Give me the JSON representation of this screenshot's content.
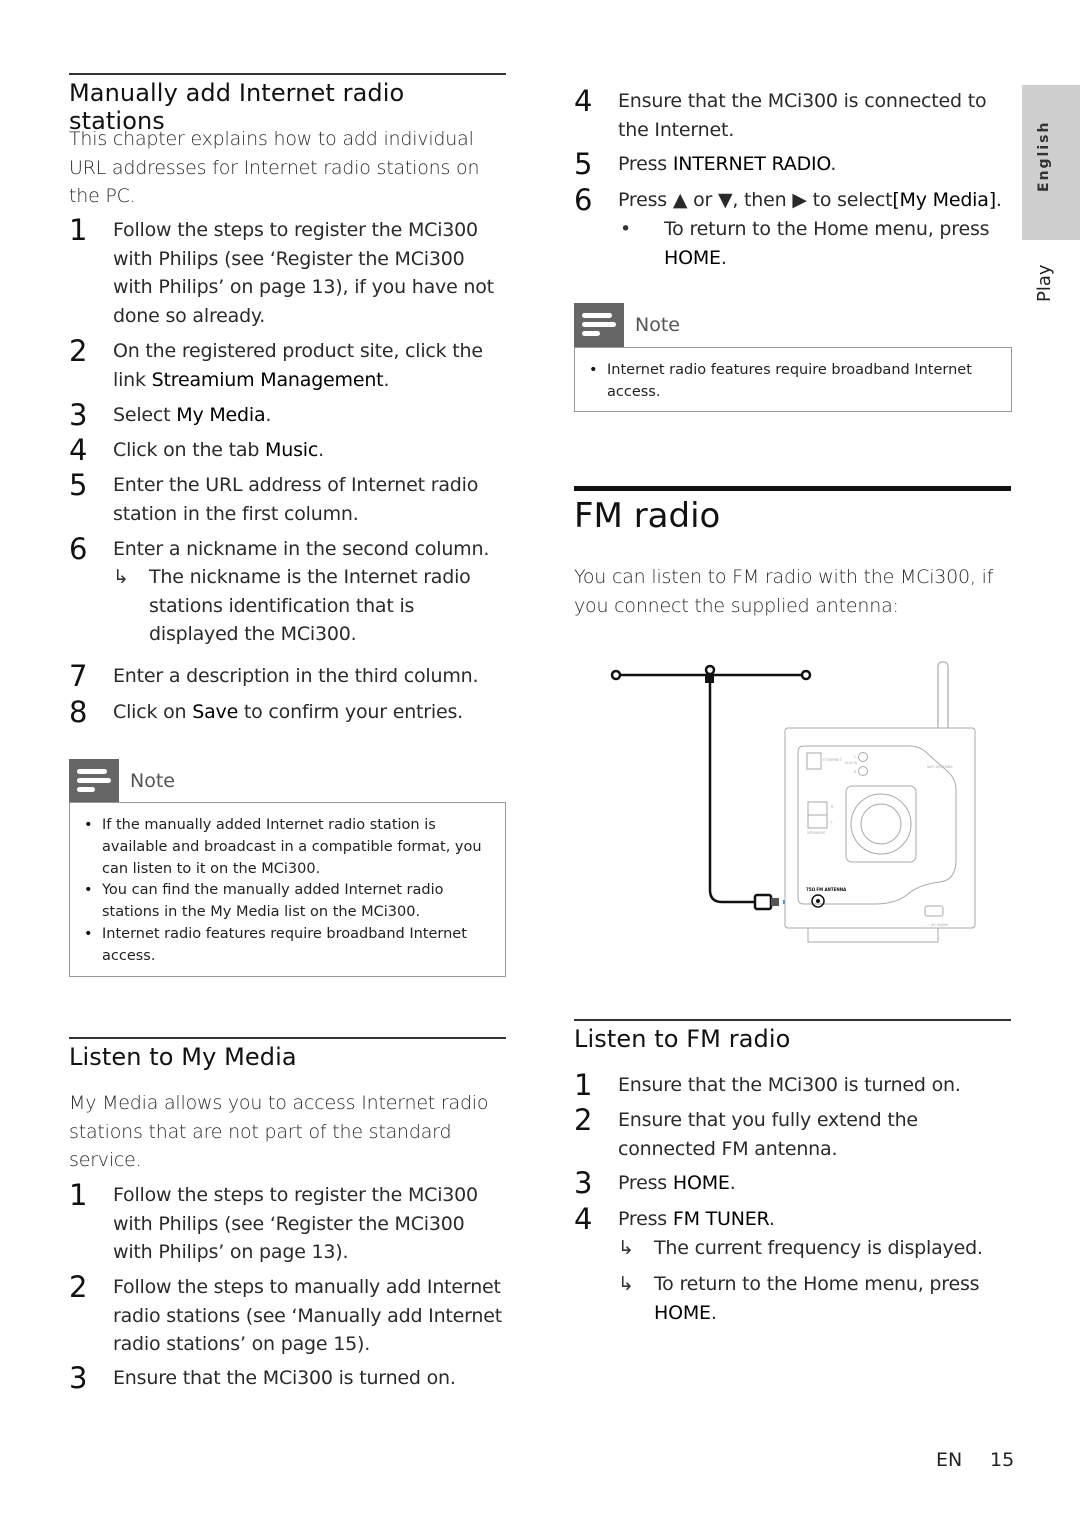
{
  "side_tabs": {
    "language": "English",
    "section": "Play"
  },
  "left": {
    "manual_add": {
      "title": "Manually add Internet radio stations",
      "intro": "This chapter explains how to add individual URL addresses for Internet radio stations on the PC.",
      "steps": [
        {
          "num": "1",
          "text": "Follow the steps to register the MCi300 with Philips (see ‘Register the MCi300 with Philips’ on page 13), if you have not done so already."
        },
        {
          "num": "2",
          "pre": "On the registered product site, click the link ",
          "bold": "Streamium Management",
          "post": "."
        },
        {
          "num": "3",
          "pre": "Select ",
          "bold": "My Media",
          "post": "."
        },
        {
          "num": "4",
          "pre": "Click on the tab ",
          "bold": "Music",
          "post": "."
        },
        {
          "num": "5",
          "text": "Enter the URL address of Internet radio station in the first column."
        },
        {
          "num": "6",
          "text": "Enter a nickname in the second column.",
          "result": "The nickname is the Internet radio stations identification that is displayed the MCi300."
        },
        {
          "num": "7",
          "text": "Enter a description in the third column."
        },
        {
          "num": "8",
          "pre": "Click on ",
          "bold": "Save",
          "post": " to confirm your entries."
        }
      ],
      "note": {
        "label": "Note",
        "items": [
          "If the manually added Internet radio station is available and broadcast in a compatible format, you can listen to it on the MCi300.",
          "You can find the manually added Internet radio stations in the My Media list on the MCi300.",
          "Internet radio features require broadband Internet access."
        ]
      }
    },
    "my_media": {
      "title": "Listen to My Media",
      "intro": "My Media allows you to access Internet radio stations that are not part of the standard service.",
      "steps": [
        {
          "num": "1",
          "text": "Follow the steps to register the MCi300 with Philips (see ‘Register the MCi300 with Philips’ on page 13)."
        },
        {
          "num": "2",
          "text": "Follow the steps to manually add Internet radio stations (see ‘Manually add Internet radio stations’ on page 15)."
        },
        {
          "num": "3",
          "text": "Ensure that the MCi300 is turned on."
        }
      ]
    }
  },
  "right": {
    "continued_steps": [
      {
        "num": "4",
        "text": "Ensure that the MCi300 is connected to the Internet."
      },
      {
        "num": "5",
        "pre": "Press ",
        "bold": "INTERNET RADIO",
        "post": "."
      },
      {
        "num": "6",
        "pre": "Press ▲ or ▼, then ▶ to select",
        "bold": "[My Media]",
        "post": ".",
        "bullet": "To return to the Home menu, press ",
        "bullet_bold": "HOME",
        "bullet_post": "."
      }
    ],
    "note": {
      "label": "Note",
      "items": [
        "Internet radio features require broadband Internet access."
      ]
    },
    "fm_radio": {
      "title": "FM radio",
      "intro": "You can listen to FM radio with the MCi300, if you connect the supplied antenna:",
      "figure_labels": {
        "ethernet": "ETHERNET",
        "aux_in": "AUX IN",
        "aux_l": "L",
        "aux_r": "R",
        "wifi_antenna": "WIFI ANTENNA",
        "speakers": "SPEAKERS",
        "spk_r": "R",
        "spk_l": "L",
        "fm_antenna": "75Ω FM ANTENNA",
        "ac_mains": "~ AC MAINS"
      }
    },
    "listen_fm": {
      "title": "Listen to FM radio",
      "steps": [
        {
          "num": "1",
          "text": "Ensure that the MCi300 is turned on."
        },
        {
          "num": "2",
          "text": "Ensure that you fully extend the connected FM antenna."
        },
        {
          "num": "3",
          "pre": "Press ",
          "bold": "HOME",
          "post": "."
        },
        {
          "num": "4",
          "pre": "Press ",
          "bold": "FM TUNER",
          "post": ".",
          "results": [
            {
              "text": "The current frequency is displayed."
            },
            {
              "pre": "To return to the Home menu, press ",
              "bold": "HOME",
              "post": "."
            }
          ]
        }
      ]
    }
  },
  "footer": {
    "lang": "EN",
    "page": "15"
  },
  "colors": {
    "note_icon": "#666666",
    "side_tab": "#cfcfcf",
    "arrow": "#2e9be6"
  }
}
